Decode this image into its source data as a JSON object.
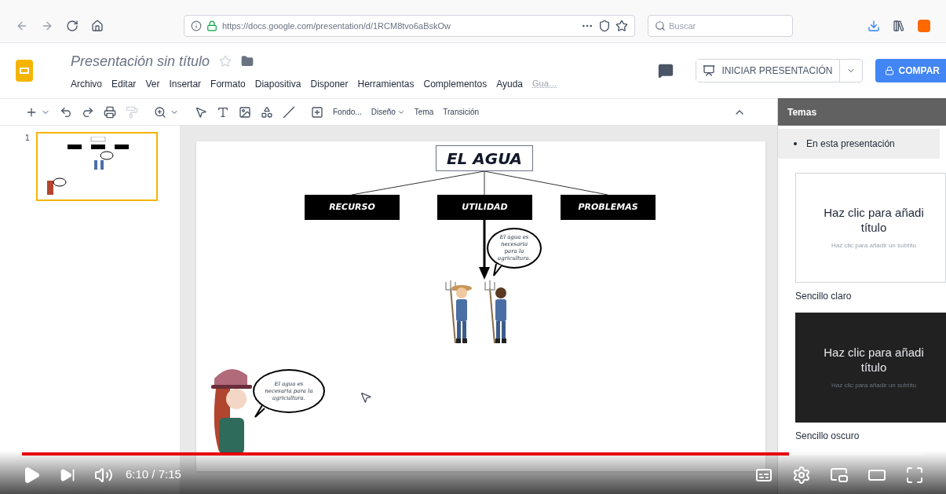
{
  "browser": {
    "url": "https://docs.google.com/presentation/d/1RCM8tvo6aBskOw",
    "search_placeholder": "Buscar"
  },
  "doc": {
    "title": "Presentación sin título",
    "starred": false,
    "menus": [
      "Archivo",
      "Editar",
      "Ver",
      "Insertar",
      "Formato",
      "Diapositiva",
      "Disponer",
      "Herramientas",
      "Complementos",
      "Ayuda"
    ],
    "save_status": "Gua…",
    "present_button": "INICIAR PRESENTACIÓN",
    "share_button": "COMPAR"
  },
  "toolbar": {
    "actions": [
      {
        "label": "Fondo...",
        "dropdown": false
      },
      {
        "label": "Diseño",
        "dropdown": true
      },
      {
        "label": "Tema",
        "dropdown": false
      },
      {
        "label": "Transición",
        "dropdown": false
      }
    ]
  },
  "filmstrip": [
    {
      "number": "1",
      "selected": true
    }
  ],
  "slide": {
    "title": "EL AGUA",
    "branches": [
      "RECURSO",
      "UTILIDAD",
      "PROBLEMAS"
    ],
    "bubbles": [
      "El agua es necesaria para la agricultura.",
      "El agua es necesaria para la agricultura."
    ]
  },
  "themes_panel": {
    "title": "Temas",
    "section": "En esta presentación",
    "themes": [
      {
        "name": "Sencillo claro",
        "kind": "light",
        "preview_title": [
          "Haz clic para añadi",
          "título"
        ],
        "preview_subtitle": "Haz clic para añadir un subtítu"
      },
      {
        "name": "Sencillo oscuro",
        "kind": "dark",
        "preview_title": [
          "Haz clic para añadi",
          "título"
        ],
        "preview_subtitle": "Haz clic para añadir un subtítu"
      }
    ]
  },
  "player": {
    "playing": false,
    "time": "6:10 / 7:15",
    "level": 0.85
  }
}
